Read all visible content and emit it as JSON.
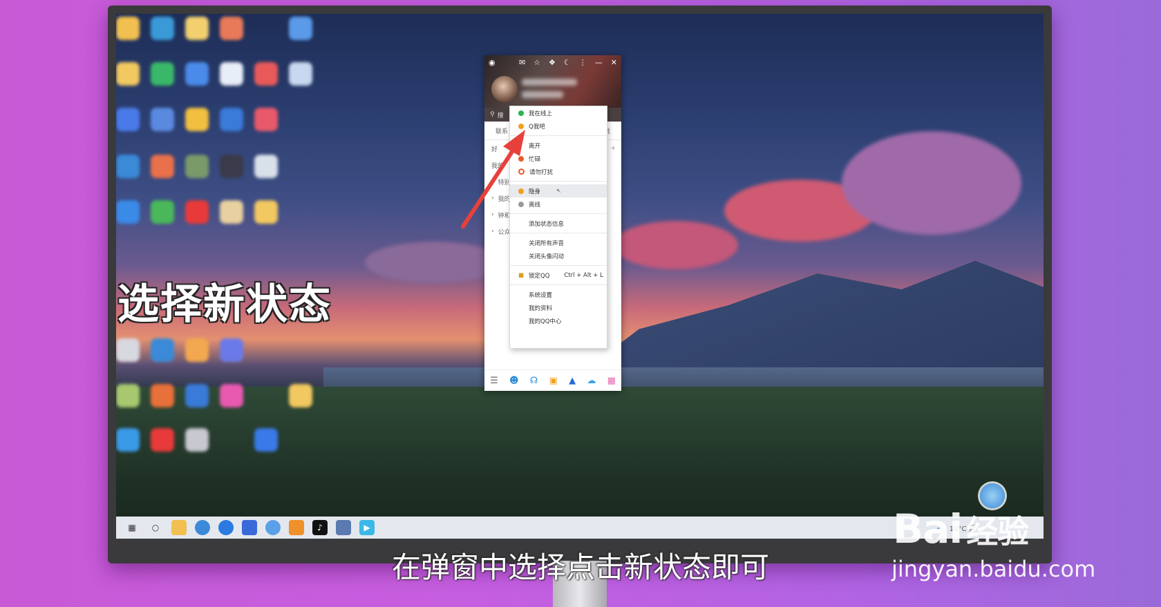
{
  "video_overlay": {
    "side_title": "选择新状态",
    "subtitle": "在弹窗中选择点击新状态即可",
    "watermark_brand": "Bai",
    "watermark_brand_cn": "经验",
    "watermark_url": "jingyan.baidu.com"
  },
  "qq_panel": {
    "search_placeholder": "搜",
    "tab_contacts": "联系",
    "tab_right": "说",
    "list": [
      "好",
      "我的",
      "特别",
      "我的",
      "钟和",
      "公众"
    ]
  },
  "status_menu": {
    "items": [
      {
        "label": "我在线上",
        "color": "#2bb24c"
      },
      {
        "label": "Q我吧",
        "color": "#f0a020"
      },
      {
        "label": "离开",
        "color": null
      },
      {
        "label": "忙碌",
        "color": "#e85a2a"
      },
      {
        "label": "请勿打扰",
        "color": "#e85a2a"
      },
      {
        "label": "隐身",
        "color": "#f0a020"
      },
      {
        "label": "离线",
        "color": "#9a9a9a"
      }
    ],
    "add_status_info": "添加状态信息",
    "mute_all": "关闭所有声音",
    "avatar_flash": "关闭头像闪动",
    "lock_qq": "锁定QQ",
    "lock_shortcut": "Ctrl + Alt + L",
    "system_settings": "系统设置",
    "my_profile": "我的资料",
    "my_qq_center": "我的QQ中心"
  },
  "taskbar": {
    "weather": "18°C 雾",
    "tray_caret": "^"
  },
  "colors": {
    "accent_arrow": "#e8403a",
    "online": "#2bb24c",
    "away": "#f0a020",
    "busy": "#e85a2a",
    "offline": "#9a9a9a"
  }
}
